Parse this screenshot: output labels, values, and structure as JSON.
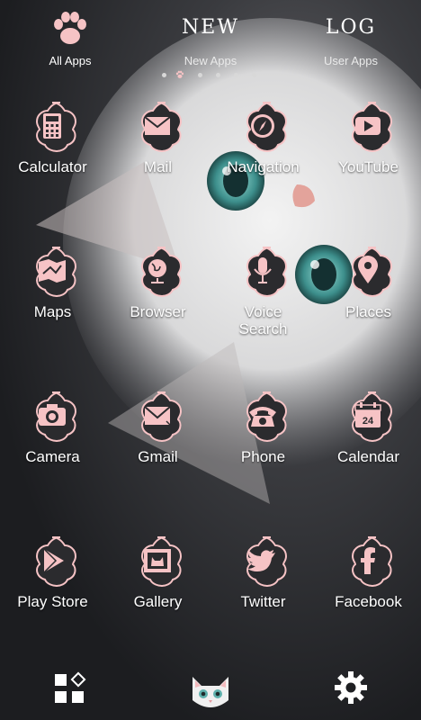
{
  "tabs": [
    {
      "label": "All Apps",
      "icon": "paw-icon"
    },
    {
      "label": "New Apps",
      "title": "NEW"
    },
    {
      "label": "User Apps",
      "title": "LOG"
    }
  ],
  "page_indicator": {
    "count": 6,
    "active_index": 1
  },
  "apps": [
    {
      "label": "Calculator",
      "icon": "calculator-icon"
    },
    {
      "label": "Mail",
      "icon": "mail-icon"
    },
    {
      "label": "Navigation",
      "icon": "compass-icon"
    },
    {
      "label": "YouTube",
      "icon": "play-icon"
    },
    {
      "label": "Maps",
      "icon": "map-icon"
    },
    {
      "label": "Browser",
      "icon": "globe-icon"
    },
    {
      "label": "Voice\nSearch",
      "icon": "microphone-icon"
    },
    {
      "label": "Places",
      "icon": "map-pin-icon"
    },
    {
      "label": "Camera",
      "icon": "camera-icon"
    },
    {
      "label": "Gmail",
      "icon": "envelope-icon"
    },
    {
      "label": "Phone",
      "icon": "phone-icon"
    },
    {
      "label": "Calendar",
      "icon": "calendar-icon"
    },
    {
      "label": "Play Store",
      "icon": "play-store-icon"
    },
    {
      "label": "Gallery",
      "icon": "picture-icon"
    },
    {
      "label": "Twitter",
      "icon": "bird-icon"
    },
    {
      "label": "Facebook",
      "icon": "facebook-icon"
    }
  ],
  "calendar_day": "24",
  "dock": [
    {
      "icon": "app-drawer-icon"
    },
    {
      "icon": "cat-face-icon"
    },
    {
      "icon": "gear-icon"
    }
  ],
  "colors": {
    "icon_bg": "#2b2b2e",
    "icon_accent": "#f6c3c5",
    "text": "#ffffff"
  }
}
